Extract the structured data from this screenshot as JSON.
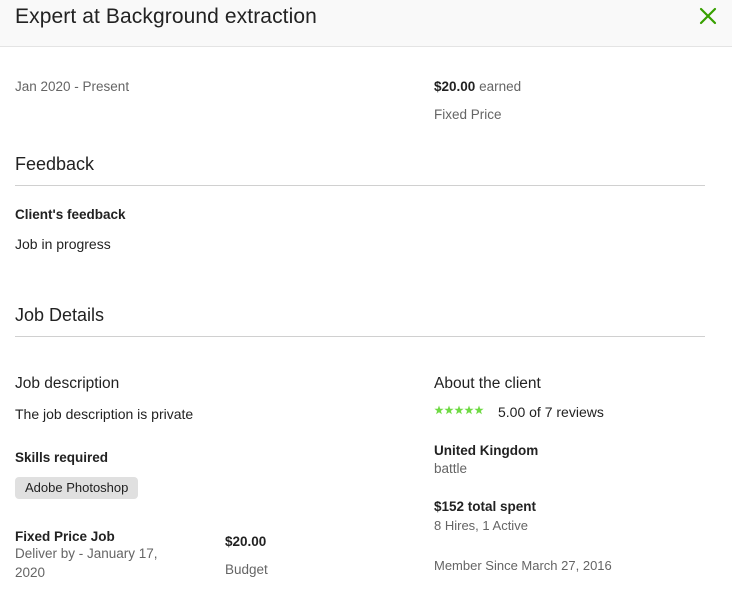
{
  "header": {
    "title": "Expert at Background extraction"
  },
  "engagement": {
    "period": "Jan 2020 - Present",
    "earned_amount": "$20.00",
    "earned_suffix": "earned",
    "contract_type": "Fixed Price"
  },
  "feedback": {
    "heading": "Feedback",
    "client_label": "Client's feedback",
    "client_text": "Job in progress"
  },
  "job_details": {
    "heading": "Job Details",
    "description_heading": "Job description",
    "description_text": "The job description is private",
    "skills_heading": "Skills required",
    "skills": [
      "Adobe Photoshop"
    ],
    "job_type": "Fixed Price Job",
    "deliver_line1": "Deliver by - January 17,",
    "deliver_line2": "2020",
    "budget_amount": "$20.00",
    "budget_label": "Budget"
  },
  "client": {
    "heading": "About the client",
    "rating": 5,
    "rating_text": "5.00 of 7 reviews",
    "country": "United Kingdom",
    "city": "battle",
    "spent": "$152 total spent",
    "hires": "8 Hires, 1 Active",
    "member_since": "Member Since March 27, 2016"
  },
  "colors": {
    "accent_green": "#37a000",
    "star_green": "#6fda44"
  },
  "icons": {
    "close": "close-icon",
    "star": "star-icon"
  }
}
